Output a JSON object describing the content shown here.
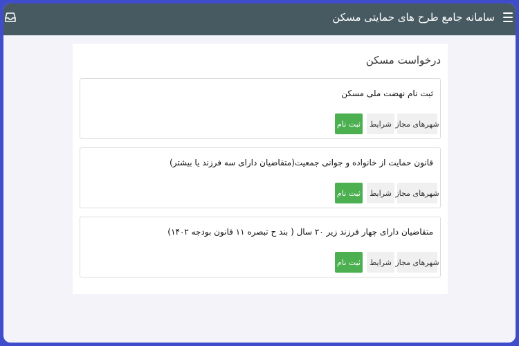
{
  "header": {
    "title": "سامانه جامع طرح های حمایتی مسکن",
    "menu_icon": "hamburger-menu-icon",
    "left_icon": "tray-icon",
    "background": "#475a62"
  },
  "panel": {
    "title": "درخواست مسکن"
  },
  "items": [
    {
      "title": "ثبت نام نهضت ملی مسکن",
      "cities_label": "شهرهای مجاز",
      "terms_label": "شرایط",
      "register_label": "ثبت نام"
    },
    {
      "title": "قانون حمایت از خانواده و جوانی جمعیت(متقاضیان دارای سه فرزند یا بیشتر)",
      "cities_label": "شهرهای مجاز",
      "terms_label": "شرایط",
      "register_label": "ثبت نام"
    },
    {
      "title": "متقاضیان دارای چهار فرزند زیر ۲۰ سال ( بند ح تبصره ۱۱ قانون بودجه ۱۴۰۲)",
      "cities_label": "شهرهای مجاز",
      "terms_label": "شرایط",
      "register_label": "ثبت نام"
    }
  ],
  "colors": {
    "border": "#3f4ccc",
    "register_button": "#4caf50"
  }
}
